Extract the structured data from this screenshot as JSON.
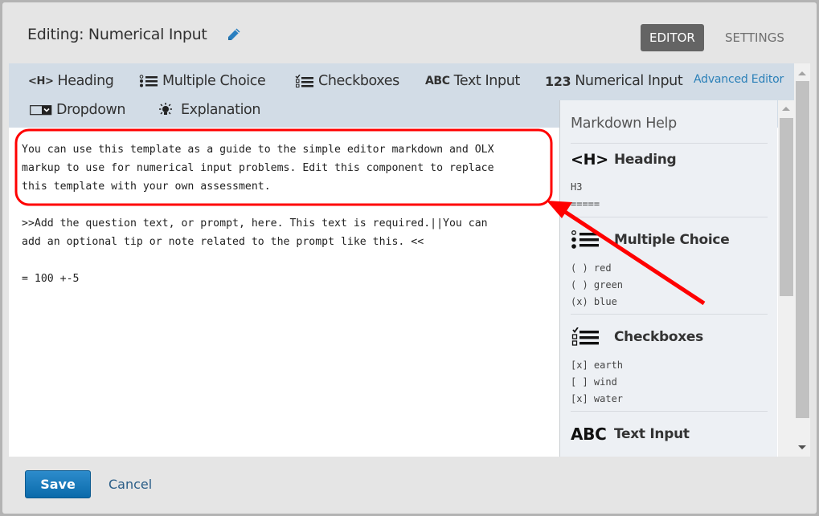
{
  "header": {
    "title": "Editing: Numerical Input",
    "edit_icon": "pencil-icon",
    "modes": [
      {
        "label": "EDITOR",
        "active": true
      },
      {
        "label": "SETTINGS",
        "active": false
      }
    ]
  },
  "toolbar": {
    "items": [
      {
        "label": "Heading",
        "icon": "heading-icon"
      },
      {
        "label": "Multiple Choice",
        "icon": "multiple-choice-icon"
      },
      {
        "label": "Checkboxes",
        "icon": "checkboxes-icon"
      },
      {
        "label": "Text Input",
        "icon": "text-input-icon"
      },
      {
        "label": "Numerical Input",
        "icon": "numerical-input-icon"
      },
      {
        "label": "Dropdown",
        "icon": "dropdown-icon"
      },
      {
        "label": "Explanation",
        "icon": "explanation-icon"
      }
    ],
    "icon_text": {
      "heading": "<H>",
      "text_input": "ABC",
      "numerical_input": "123"
    },
    "advanced_editor": "Advanced Editor"
  },
  "editor": {
    "paragraphs": [
      "You can use this template as a guide to the simple editor markdown and OLX\nmarkup to use for numerical input problems. Edit this component to replace\nthis template with your own assessment.",
      ">>Add the question text, or prompt, here. This text is required.||You can\nadd an optional tip or note related to the prompt like this. <<",
      "= 100 +-5"
    ]
  },
  "help": {
    "title": "Markdown Help",
    "sections": [
      {
        "title": "Heading",
        "icon": "heading-icon",
        "example": "H3\n====="
      },
      {
        "title": "Multiple Choice",
        "icon": "multiple-choice-icon",
        "example": "( ) red\n( ) green\n(x) blue"
      },
      {
        "title": "Checkboxes",
        "icon": "checkboxes-icon",
        "example": "[x] earth\n[ ] wind\n[x] water"
      },
      {
        "title": "Text Input",
        "icon": "text-input-icon",
        "example": ""
      }
    ]
  },
  "footer": {
    "save": "Save",
    "cancel": "Cancel"
  },
  "colors": {
    "accent_blue": "#0a6aaa",
    "link_blue": "#2b80b8",
    "annotation_red": "#ff0000",
    "active_mode_bg": "#646464",
    "toolbar_bg": "#d2dce6"
  }
}
